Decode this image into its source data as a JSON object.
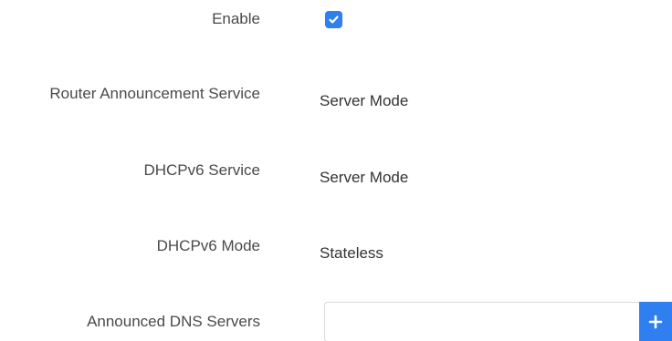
{
  "form": {
    "enable": {
      "label": "Enable",
      "checked": true
    },
    "ra_service": {
      "label": "Router Announcement Service",
      "value": "Server Mode"
    },
    "dhcpv6_service": {
      "label": "DHCPv6 Service",
      "value": "Server Mode"
    },
    "dhcpv6_mode": {
      "label": "DHCPv6 Mode",
      "value": "Stateless"
    },
    "dns_servers": {
      "label": "Announced DNS Servers",
      "value": "",
      "placeholder": ""
    }
  },
  "icons": {
    "checkbox": "check-icon",
    "add": "plus-icon"
  },
  "colors": {
    "accent": "#2f7ff0",
    "label_text": "#4a4a4a",
    "value_text": "#333333"
  }
}
